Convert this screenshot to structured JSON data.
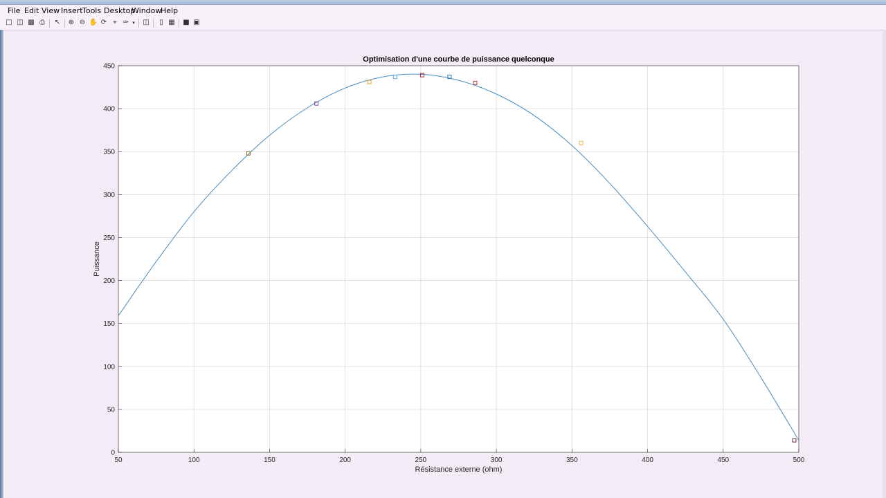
{
  "window": {
    "menu": [
      "File",
      "Edit",
      "View",
      "Insert",
      "Tools",
      "Desktop",
      "Window",
      "Help"
    ]
  },
  "toolbar": {
    "icons": [
      "new-figure-icon",
      "open-file-icon",
      "save-icon",
      "print-icon",
      "pointer-icon",
      "zoom-in-icon",
      "zoom-out-icon",
      "pan-icon",
      "rotate-icon",
      "data-cursor-icon",
      "brush-icon",
      "link-plot-icon",
      "colorbar-icon",
      "legend-icon",
      "hide-plot-tools-icon",
      "show-plot-tools-icon"
    ]
  },
  "colors": {
    "curve": "#4a8cbf",
    "grid": "#dcdcdc",
    "axes_bg": "#ffffff"
  },
  "chart_data": {
    "type": "line",
    "title": "Optimisation d'une courbe de puissance quelconque",
    "xlabel": "Résistance externe (ohm)",
    "ylabel": "Puissance",
    "xlim": [
      50,
      500
    ],
    "ylim": [
      0,
      450
    ],
    "xticks": [
      50,
      100,
      150,
      200,
      250,
      300,
      350,
      400,
      450,
      500
    ],
    "yticks": [
      0,
      50,
      100,
      150,
      200,
      250,
      300,
      350,
      400,
      450
    ],
    "grid": true,
    "curve": {
      "x": [
        50,
        75,
        100,
        125,
        150,
        175,
        200,
        225,
        250,
        275,
        300,
        325,
        350,
        375,
        400,
        425,
        450,
        475,
        500
      ],
      "y": [
        159,
        222,
        280,
        328,
        369,
        401,
        424,
        437,
        440,
        433,
        417,
        392,
        357,
        313,
        263,
        210,
        155,
        87,
        14
      ]
    },
    "markers": [
      {
        "x": 136,
        "y": 348,
        "color": "#8a6a1a",
        "shape": "square"
      },
      {
        "x": 181,
        "y": 406,
        "color": "#7e4f9a",
        "shape": "square"
      },
      {
        "x": 216,
        "y": 431,
        "color": "#d9a51c",
        "shape": "square"
      },
      {
        "x": 233,
        "y": 437,
        "color": "#5aaee0",
        "shape": "square"
      },
      {
        "x": 251,
        "y": 439,
        "color": "#b0213a",
        "shape": "square"
      },
      {
        "x": 269,
        "y": 437,
        "color": "#2f78b0",
        "shape": "square"
      },
      {
        "x": 286,
        "y": 430,
        "color": "#a3403a",
        "shape": "square"
      },
      {
        "x": 356,
        "y": 360,
        "color": "#e6b84a",
        "shape": "square"
      },
      {
        "x": 497,
        "y": 14,
        "color": "#6a2a4a",
        "shape": "square"
      }
    ]
  }
}
